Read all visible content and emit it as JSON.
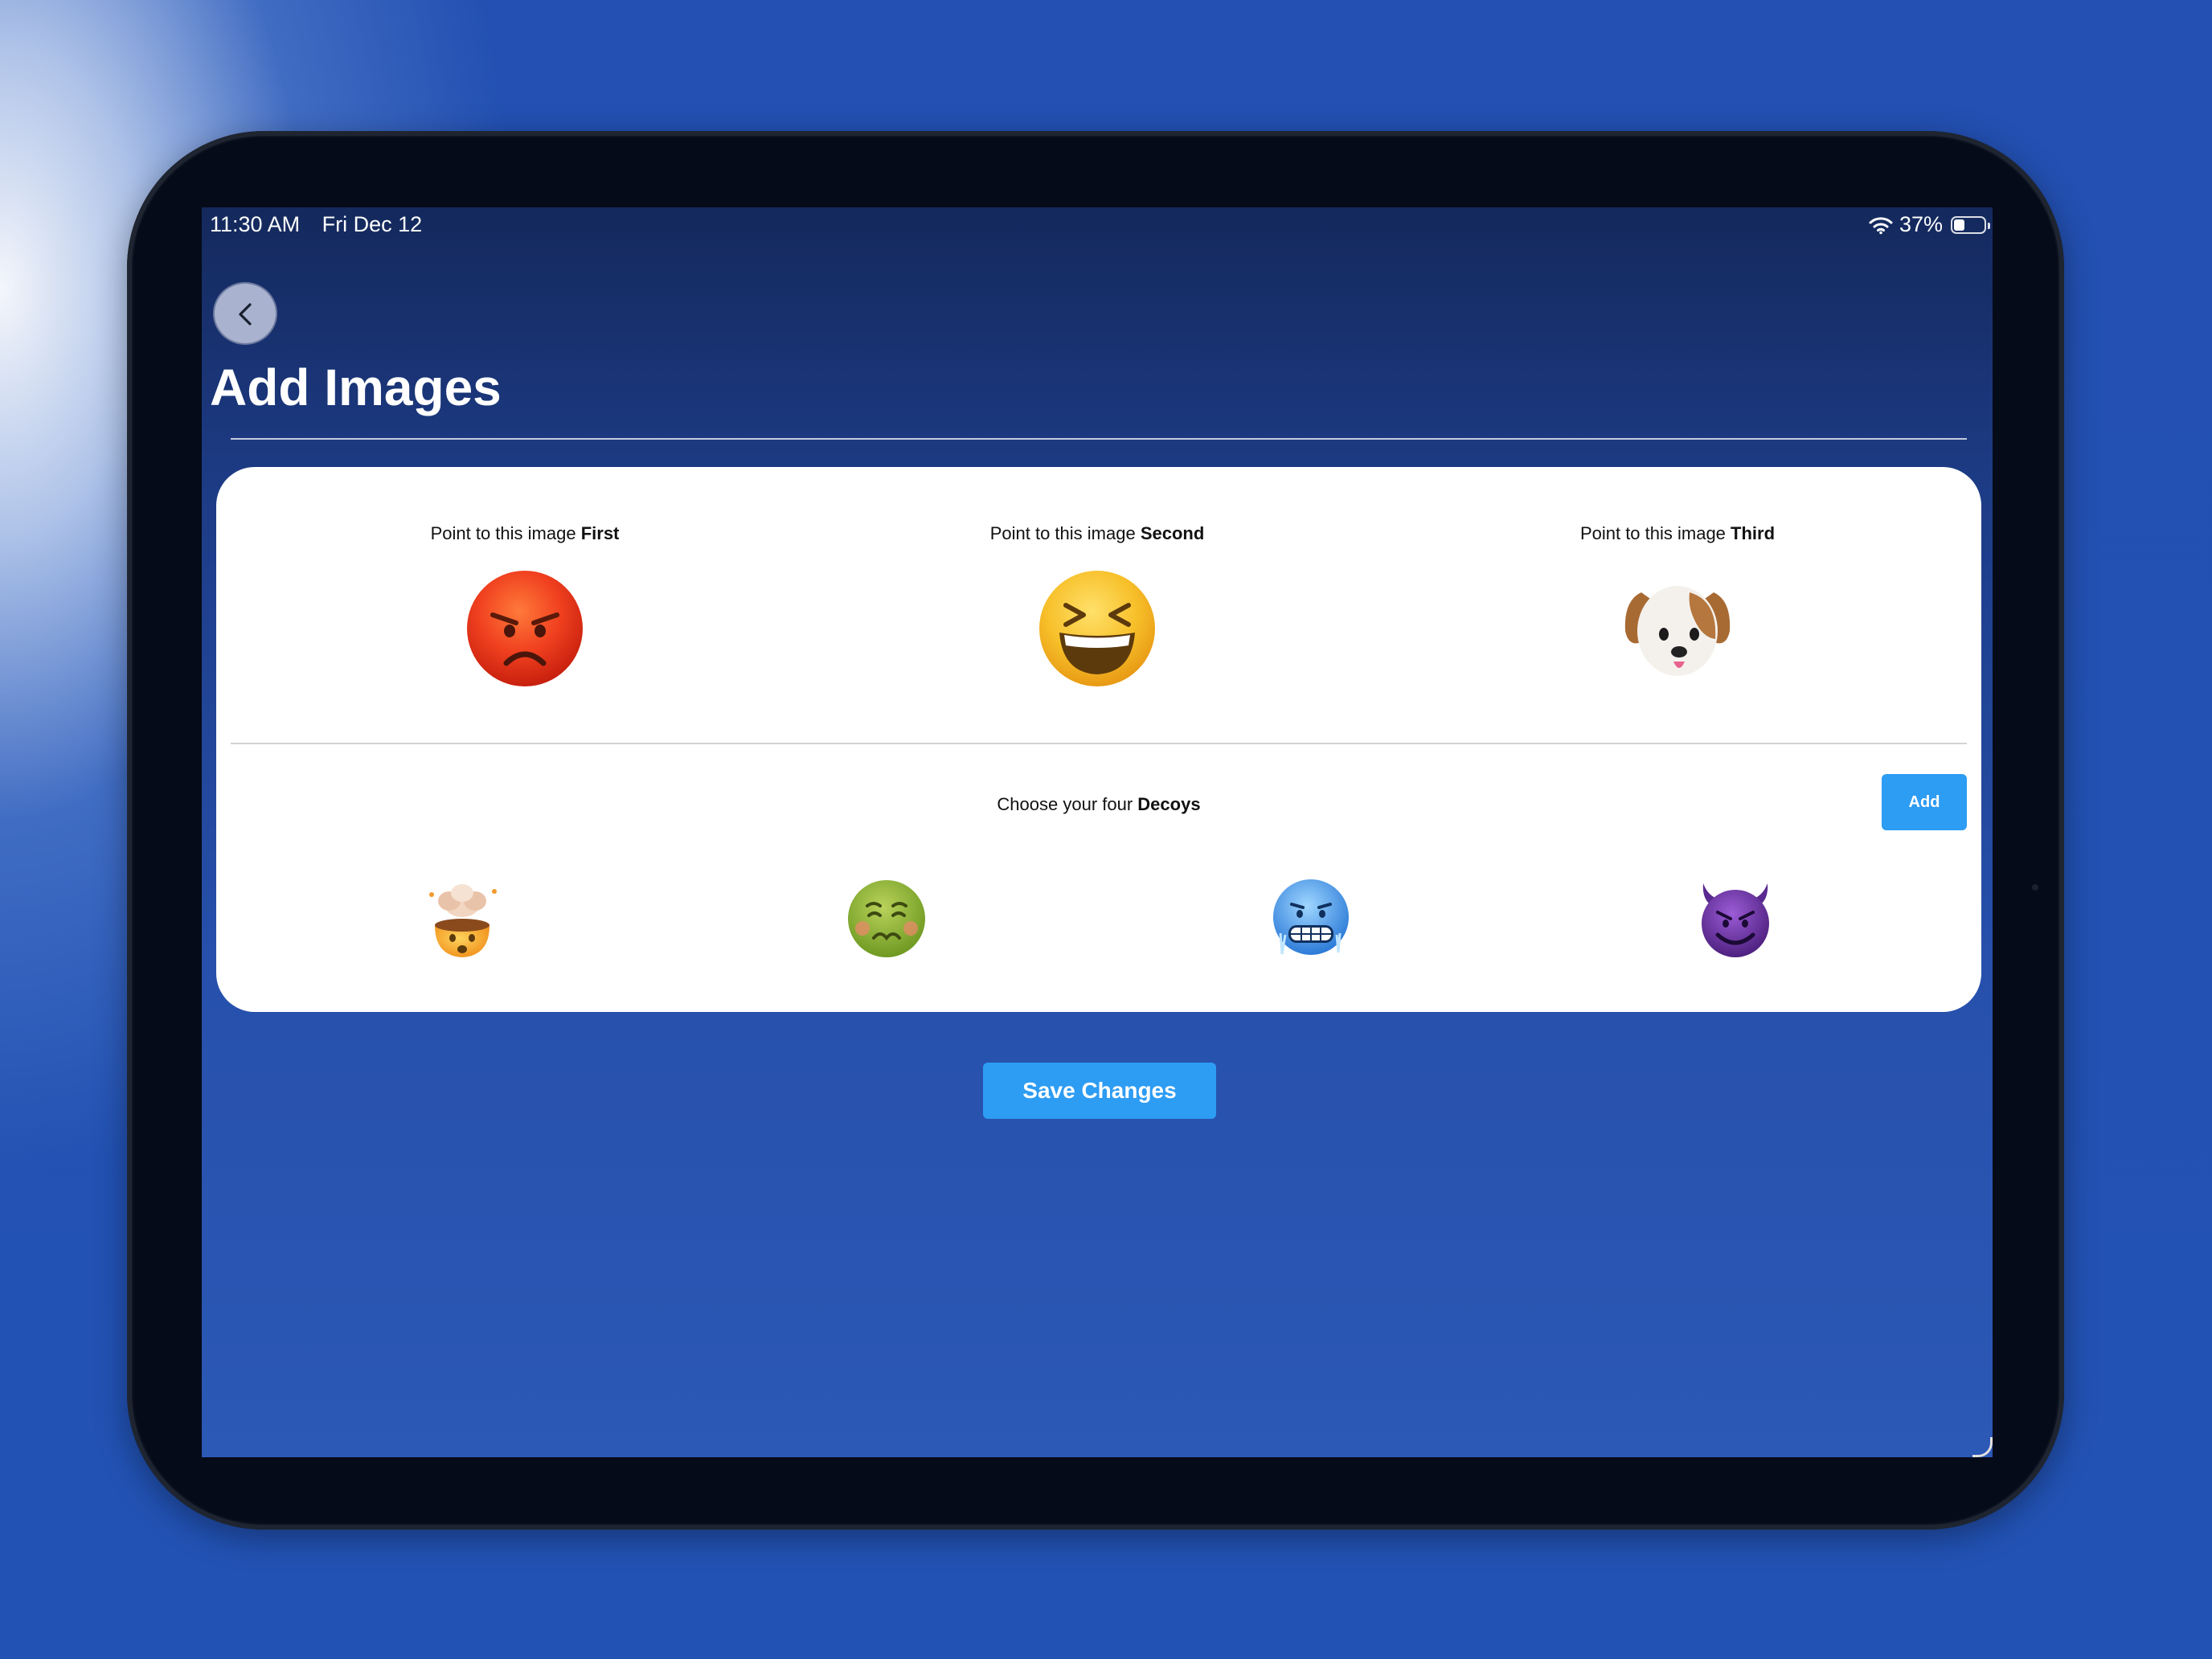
{
  "status_bar": {
    "time": "11:30 AM",
    "date": "Fri Dec 12",
    "battery_text": "37%",
    "battery_level": 0.37,
    "icons": [
      "wifi-icon",
      "battery-icon"
    ]
  },
  "header": {
    "back_icon": "chevron-left-icon",
    "title": "Add Images"
  },
  "targets": [
    {
      "prefix": "Point to this image ",
      "order": "First",
      "emoji": "angry-face-icon"
    },
    {
      "prefix": "Point to this image ",
      "order": "Second",
      "emoji": "grinning-squinting-face-icon"
    },
    {
      "prefix": "Point to this image ",
      "order": "Third",
      "emoji": "dog-face-icon"
    }
  ],
  "decoys": {
    "prefix": "Choose your four ",
    "emphasis": "Decoys",
    "add_label": "Add",
    "items": [
      "exploding-head-icon",
      "nauseated-face-icon",
      "cold-face-icon",
      "smiling-devil-icon"
    ]
  },
  "actions": {
    "save_label": "Save Changes"
  },
  "colors": {
    "accent_button": "#2d9cf3",
    "card_background": "#ffffff",
    "screen_background_top": "#14295c",
    "screen_background_bottom": "#2c58b6"
  }
}
